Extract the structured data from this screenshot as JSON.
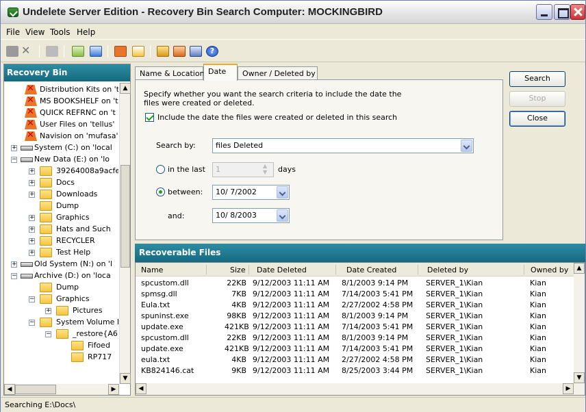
{
  "window": {
    "title": "Undelete Server Edition - Recovery Bin Search   Computer: MOCKINGBIRD"
  },
  "menu": [
    "File",
    "View",
    "Tools",
    "Help"
  ],
  "toolbar": {
    "icons": [
      "recover-icon",
      "delete-icon",
      "purge-icon",
      "properties-icon",
      "refresh-icon",
      "empty-bin-icon",
      "export-icon",
      "search-icon",
      "filter-icon",
      "settings-icon",
      "help-icon"
    ]
  },
  "left_pane": {
    "title": "Recovery Bin",
    "tree": [
      {
        "label": "Distribution Kits on 't",
        "icon": "recovery-bin-icon"
      },
      {
        "label": "MS BOOKSHELF on 't",
        "icon": "recovery-bin-icon"
      },
      {
        "label": "QUICK REFRNC on 't",
        "icon": "recovery-bin-icon"
      },
      {
        "label": "User Files on 'tellus'",
        "icon": "recovery-bin-icon"
      },
      {
        "label": "Navision on 'mufasa'",
        "icon": "recovery-bin-icon"
      },
      {
        "label": "System (C:) on 'local",
        "icon": "drive-icon"
      },
      {
        "label": "New Data (E:) on 'lo",
        "icon": "drive-icon"
      },
      {
        "label": "39264008a9acfe",
        "icon": "folder-icon"
      },
      {
        "label": "Docs",
        "icon": "folder-icon"
      },
      {
        "label": "Downloads",
        "icon": "folder-icon"
      },
      {
        "label": "Dump",
        "icon": "folder-icon"
      },
      {
        "label": "Graphics",
        "icon": "folder-icon"
      },
      {
        "label": "Hats and Such",
        "icon": "folder-icon"
      },
      {
        "label": "RECYCLER",
        "icon": "folder-icon"
      },
      {
        "label": "Test Help",
        "icon": "folder-icon"
      },
      {
        "label": "Old System (N:) on 'l",
        "icon": "drive-icon"
      },
      {
        "label": "Archive (D:) on 'loca",
        "icon": "drive-icon"
      },
      {
        "label": "Dump",
        "icon": "folder-icon"
      },
      {
        "label": "Graphics",
        "icon": "folder-icon"
      },
      {
        "label": "Pictures",
        "icon": "folder-icon"
      },
      {
        "label": "System Volume I",
        "icon": "folder-icon"
      },
      {
        "label": "_restore{A6",
        "icon": "folder-icon"
      },
      {
        "label": "Fifoed",
        "icon": "folder-icon"
      },
      {
        "label": "RP717",
        "icon": "folder-icon"
      }
    ]
  },
  "tabs": [
    "Name & Location",
    "Date",
    "Owner / Deleted by"
  ],
  "date_panel": {
    "description": "Specify whether you want the search criteria to include the date the files were created or deleted.",
    "include_label": "Include the date the files were created or deleted in this search",
    "search_by_label": "Search by:",
    "search_by_value": "files Deleted",
    "in_the_last_label": "in the last",
    "in_the_last_value": "1",
    "days_label": "days",
    "between_label": "between:",
    "between_value": "10/  7/2002",
    "and_label": "and:",
    "and_value": "10/  8/2003"
  },
  "buttons": {
    "search": "Search",
    "stop": "Stop",
    "close": "Close"
  },
  "recoverable": {
    "title": "Recoverable Files",
    "columns": [
      "Name",
      "Size",
      "Date Deleted",
      "Date Created",
      "Deleted by",
      "Owned by"
    ],
    "rows": [
      [
        "spcustom.dll",
        "22KB",
        "9/12/2003 11:11 AM",
        "8/1/2003 9:14 PM",
        "SERVER_1\\Kian",
        "Kian"
      ],
      [
        "spmsg.dll",
        "7KB",
        "9/12/2003 11:11 AM",
        "7/14/2003 5:41 PM",
        "SERVER_1\\Kian",
        "Kian"
      ],
      [
        "Eula.txt",
        "4KB",
        "9/12/2003 11:11 AM",
        "2/27/2002 4:58 PM",
        "SERVER_1\\Kian",
        "Kian"
      ],
      [
        "spuninst.exe",
        "98KB",
        "9/12/2003 11:11 AM",
        "8/1/2003 9:14 PM",
        "SERVER_1\\Kian",
        "Kian"
      ],
      [
        "update.exe",
        "421KB",
        "9/12/2003 11:11 AM",
        "7/14/2003 5:41 PM",
        "SERVER_1\\Kian",
        "Kian"
      ],
      [
        "spcustom.dll",
        "22KB",
        "9/12/2003 11:11 AM",
        "8/1/2003 9:14 PM",
        "SERVER_1\\Kian",
        "Kian"
      ],
      [
        "update.exe",
        "421KB",
        "9/12/2003 11:11 AM",
        "7/14/2003 5:41 PM",
        "SERVER_1\\Kian",
        "Kian"
      ],
      [
        "eula.txt",
        "4KB",
        "9/12/2003 11:11 AM",
        "2/27/2002 4:58 PM",
        "SERVER_1\\Kian",
        "Kian"
      ],
      [
        "KB824146.cat",
        "9KB",
        "9/12/2003 11:11 AM",
        "8/25/2003 3:44 PM",
        "SERVER_1\\Kian",
        "Kian"
      ]
    ]
  },
  "status": "Searching E:\\Docs\\",
  "colors": {
    "pane_header": "#146a80",
    "accent_tab": "#f5a623",
    "check": "#21a121"
  }
}
